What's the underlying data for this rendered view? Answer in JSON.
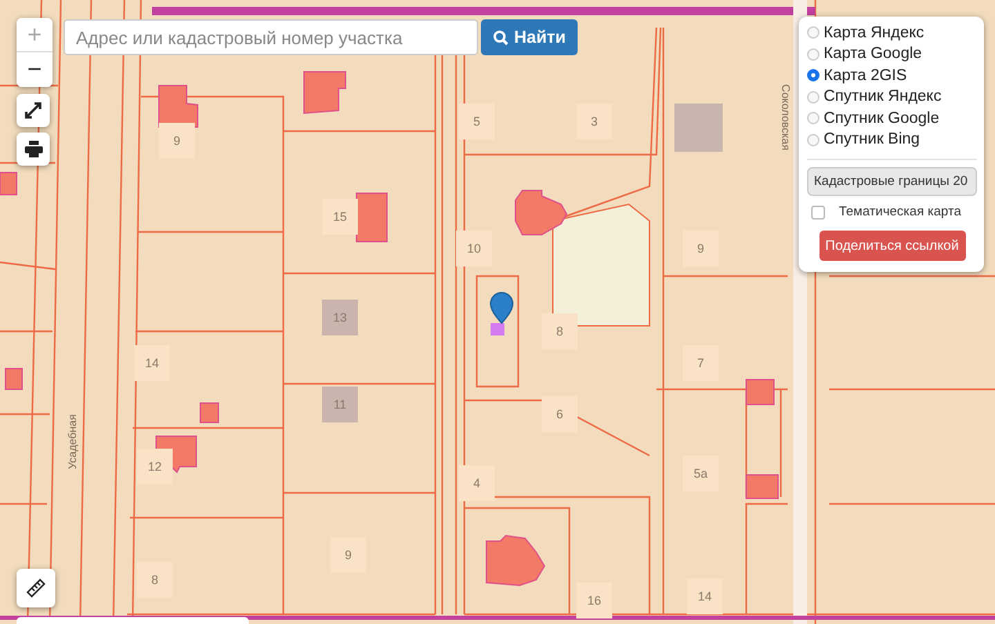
{
  "search": {
    "placeholder": "Адрес или кадастровый номер участка",
    "button": "Найти"
  },
  "zoom": {
    "in": "+",
    "out": "−"
  },
  "layers": [
    {
      "label": "Карта Яндекс",
      "selected": false
    },
    {
      "label": "Карта Google",
      "selected": false
    },
    {
      "label": "Карта 2GIS",
      "selected": true
    },
    {
      "label": "Спутник Яндекс",
      "selected": false
    },
    {
      "label": "Спутник Google",
      "selected": false
    },
    {
      "label": "Спутник Bing",
      "selected": false
    }
  ],
  "overlay_select": {
    "value": "Кадастровые границы 20"
  },
  "thematic": {
    "label": "Тематическая карта",
    "checked": false
  },
  "share_button": "Поделиться ссылкой",
  "map": {
    "street_labels": [
      "Усадебная",
      "Соколовская"
    ],
    "house_numbers": [
      "9",
      "5",
      "3",
      "15",
      "10",
      "9",
      "13",
      "8",
      "14",
      "7",
      "11",
      "6",
      "12",
      "4",
      "5а",
      "9",
      "8",
      "16",
      "14"
    ]
  }
}
